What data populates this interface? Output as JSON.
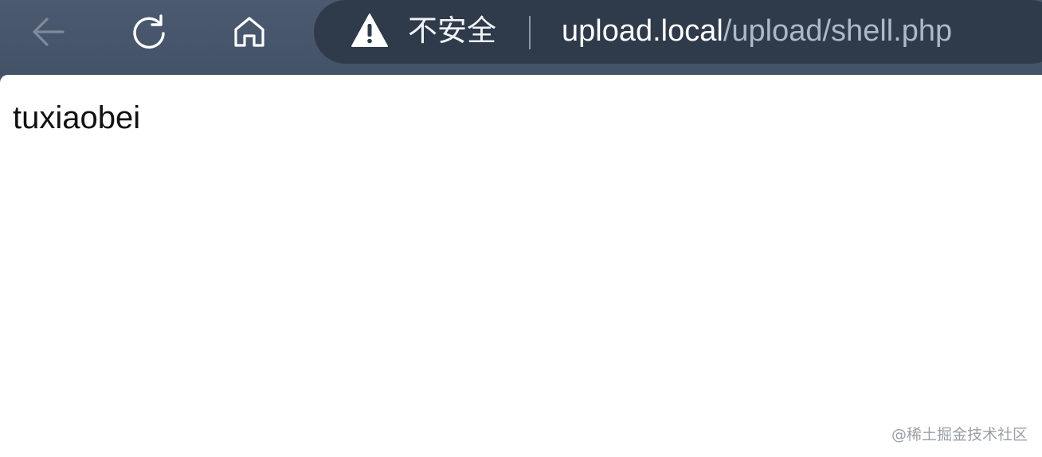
{
  "browser": {
    "nav": {
      "back_icon": "arrow-left-icon",
      "reload_icon": "reload-icon",
      "home_icon": "home-icon"
    },
    "address_bar": {
      "security_icon": "warning-icon",
      "security_label": "不安全",
      "url_host": "upload.local",
      "url_path": "/upload/shell.php"
    }
  },
  "page": {
    "body_text": "tuxiaobei"
  },
  "watermark": "@稀土掘金技术社区",
  "colors": {
    "toolbar": "#465569",
    "address_bar": "#2f3a4b",
    "url_host": "#ffffff",
    "url_path": "#aeb8c6",
    "page_background": "#ffffff"
  }
}
